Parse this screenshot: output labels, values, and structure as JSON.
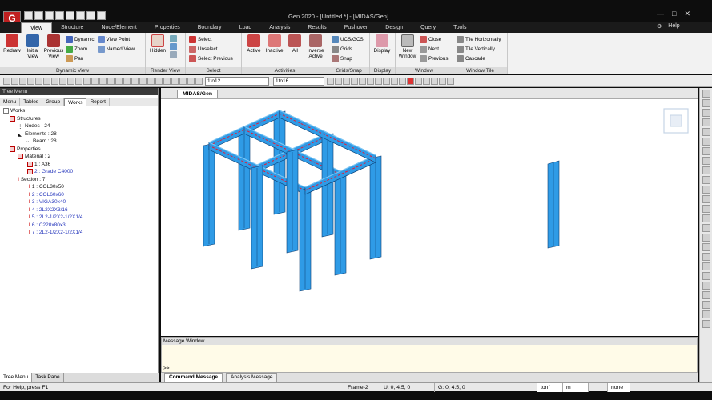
{
  "window": {
    "title": "Gen 2020 - [Untitled *] - [MIDAS/Gen]",
    "logo": "G"
  },
  "menu": {
    "tabs": [
      "View",
      "Structure",
      "Node/Element",
      "Properties",
      "Boundary",
      "Load",
      "Analysis",
      "Results",
      "Pushover",
      "Design",
      "Query",
      "Tools"
    ],
    "active": "View",
    "help_label": "Help"
  },
  "ribbon": {
    "dynamic_view": {
      "label": "Dynamic View",
      "redraw": "Redraw",
      "initial": "Initial View",
      "previous": "Previous View",
      "dynamic": "Dynamic",
      "zoom": "Zoom",
      "pan": "Pan",
      "view_point": "View Point",
      "named_view": "Named View"
    },
    "render_view": {
      "label": "Render View",
      "hidden": "Hidden"
    },
    "select": {
      "label": "Select",
      "select": "Select",
      "unselect": "Unselect",
      "select_previous": "Select Previous"
    },
    "activities": {
      "label": "Activities",
      "active": "Active",
      "inactive": "Inactive",
      "all": "All",
      "inverse_active": "Inverse Active"
    },
    "grids_snap": {
      "label": "Grids/Snap",
      "ucs": "UCS/GCS",
      "grids": "Grids",
      "snap": "Snap"
    },
    "display": {
      "label": "Display",
      "display": "Display"
    },
    "window": {
      "label": "Window",
      "new_window": "New Window",
      "close": "Close",
      "next": "Next",
      "previous": "Previous"
    },
    "window_tile": {
      "label": "Window Tile",
      "tile_h": "Tile Horizontally",
      "tile_v": "Tile Vertically",
      "cascade": "Cascade"
    }
  },
  "toolbar": {
    "combo1": "1to12",
    "combo2": "1to16"
  },
  "tree_menu": {
    "title": "Tree Menu",
    "tabs": [
      "Menu",
      "Tables",
      "Group",
      "Works",
      "Report"
    ],
    "active_tab": "Works",
    "items": {
      "works": "Works",
      "structures": "Structures",
      "nodes": "Nodes : 24",
      "elements": "Elements : 28",
      "beam": "Beam : 28",
      "properties": "Properties",
      "material": "Material : 2",
      "mat1": "1 : A36",
      "mat2": "2 : Grade C4000",
      "section": "Section : 7",
      "sec1": "1 : COL30x50",
      "sec2": "2 : COL60x60",
      "sec3": "3 : VIGA30x40",
      "sec4": "4 : 2L2X2X3/16",
      "sec5": "5 : 2L2-1/2X2-1/2X1/4",
      "sec6": "6 : C220x80x3",
      "sec7": "7 : 2L2-1/2X2-1/2X1/4"
    },
    "bottom_tabs": [
      "Tree Menu",
      "Task Pane"
    ]
  },
  "viewport": {
    "tab": "MIDAS/Gen",
    "colors": {
      "member": "#2f9be6",
      "edge": "#0d3f73",
      "highlight": "#e01e3a"
    }
  },
  "message": {
    "title": "Message Window",
    "prompt": ">>",
    "tabs": [
      "Command Message",
      "Analysis Message"
    ]
  },
  "status": {
    "help": "For Help, press F1",
    "frame": "Frame-2",
    "u": "U: 0, 4.5, 0",
    "g": "G: 0, 4.5, 0",
    "force": "tonf",
    "length": "m",
    "none": "none"
  }
}
